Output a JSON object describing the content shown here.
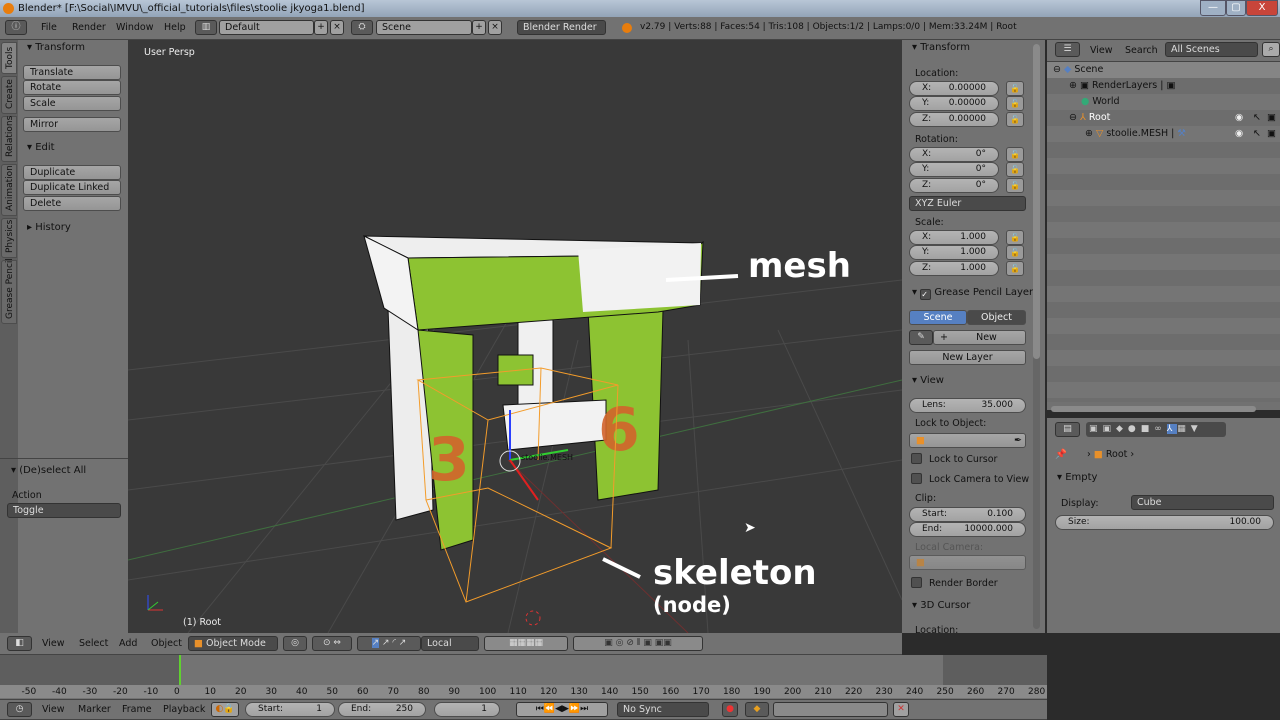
{
  "window": {
    "title": "Blender* [F:\\Social\\IMVU\\_official_tutorials\\files\\stoolie jkyoga1.blend]",
    "minimize": "—",
    "maximize": "▢",
    "close": "X"
  },
  "info_header": {
    "menus": [
      "File",
      "Render",
      "Window",
      "Help"
    ],
    "layout": "Default",
    "scene": "Scene",
    "engine": "Blender Render",
    "stats": "v2.79 | Verts:88 | Faces:54 | Tris:108 | Objects:1/2 | Lamps:0/0 | Mem:33.24M | Root"
  },
  "toolshelf": {
    "tabs": [
      "Tools",
      "Create",
      "Relations",
      "Animation",
      "Physics",
      "Grease Pencil"
    ],
    "transform": {
      "title": "Transform",
      "buttons": [
        "Translate",
        "Rotate",
        "Scale"
      ],
      "mirror": "Mirror"
    },
    "edit": {
      "title": "Edit",
      "buttons": [
        "Duplicate",
        "Duplicate Linked",
        "Delete"
      ]
    },
    "history": {
      "title": "History"
    },
    "operator": {
      "title": "(De)select All",
      "action_label": "Action",
      "action_value": "Toggle"
    }
  },
  "viewport": {
    "view_name": "User Persp",
    "object_label": "(1) Root",
    "origin_label": "stoolie.MESH",
    "annotations": {
      "mesh": "mesh",
      "skeleton": "skeleton",
      "node": "(node)"
    }
  },
  "npanel": {
    "transform": {
      "title": "Transform",
      "location_label": "Location:",
      "location": [
        {
          "axis": "X:",
          "value": "0.00000"
        },
        {
          "axis": "Y:",
          "value": "0.00000"
        },
        {
          "axis": "Z:",
          "value": "0.00000"
        }
      ],
      "rotation_label": "Rotation:",
      "rotation": [
        {
          "axis": "X:",
          "value": "0°"
        },
        {
          "axis": "Y:",
          "value": "0°"
        },
        {
          "axis": "Z:",
          "value": "0°"
        }
      ],
      "rotation_mode": "XYZ Euler",
      "scale_label": "Scale:",
      "scale": [
        {
          "axis": "X:",
          "value": "1.000"
        },
        {
          "axis": "Y:",
          "value": "1.000"
        },
        {
          "axis": "Z:",
          "value": "1.000"
        }
      ]
    },
    "grease": {
      "title": "Grease Pencil Layers",
      "enabled": true,
      "scene": "Scene",
      "object": "Object",
      "new": "New",
      "new_layer": "New Layer"
    },
    "view": {
      "title": "View",
      "lens_label": "Lens:",
      "lens": "35.000",
      "lock_object": "Lock to Object:",
      "lock_cursor": "Lock to Cursor",
      "lock_camera": "Lock Camera to View",
      "clip": "Clip:",
      "start_label": "Start:",
      "start": "0.100",
      "end_label": "End:",
      "end": "10000.000",
      "local_camera": "Local Camera:",
      "render_border": "Render Border"
    },
    "cursor": {
      "title": "3D Cursor",
      "location_label": "Location:"
    }
  },
  "outliner": {
    "view": "View",
    "search": "Search",
    "filter": "All Scenes",
    "items": [
      {
        "label": "Scene"
      },
      {
        "label": "RenderLayers"
      },
      {
        "label": "World"
      },
      {
        "label": "Root"
      },
      {
        "label": "stoolie.MESH"
      }
    ]
  },
  "properties": {
    "breadcrumb": "Root",
    "panel": "Empty",
    "display_label": "Display:",
    "display": "Cube",
    "size_label": "Size:",
    "size": "100.00",
    "active_tab": "object-data"
  },
  "view3d_header": {
    "menus": [
      "View",
      "Select",
      "Add",
      "Object"
    ],
    "mode": "Object Mode",
    "orientation": "Local"
  },
  "timeline": {
    "ticks": [
      "-50",
      "-40",
      "-30",
      "-20",
      "-10",
      "0",
      "10",
      "20",
      "30",
      "40",
      "50",
      "60",
      "70",
      "80",
      "90",
      "100",
      "110",
      "120",
      "130",
      "140",
      "150",
      "160",
      "170",
      "180",
      "190",
      "200",
      "210",
      "220",
      "230",
      "240",
      "250",
      "260",
      "270",
      "280"
    ],
    "menus": [
      "View",
      "Marker",
      "Frame",
      "Playback"
    ],
    "start_label": "Start:",
    "start": "1",
    "end_label": "End:",
    "end": "250",
    "current": "1",
    "sync": "No Sync",
    "current_frame": 0
  },
  "colors": {
    "accent": "#5680c2",
    "selection": "#f39c2b",
    "mesh_green": "#8dc332",
    "mesh_orange": "#d2642c"
  }
}
